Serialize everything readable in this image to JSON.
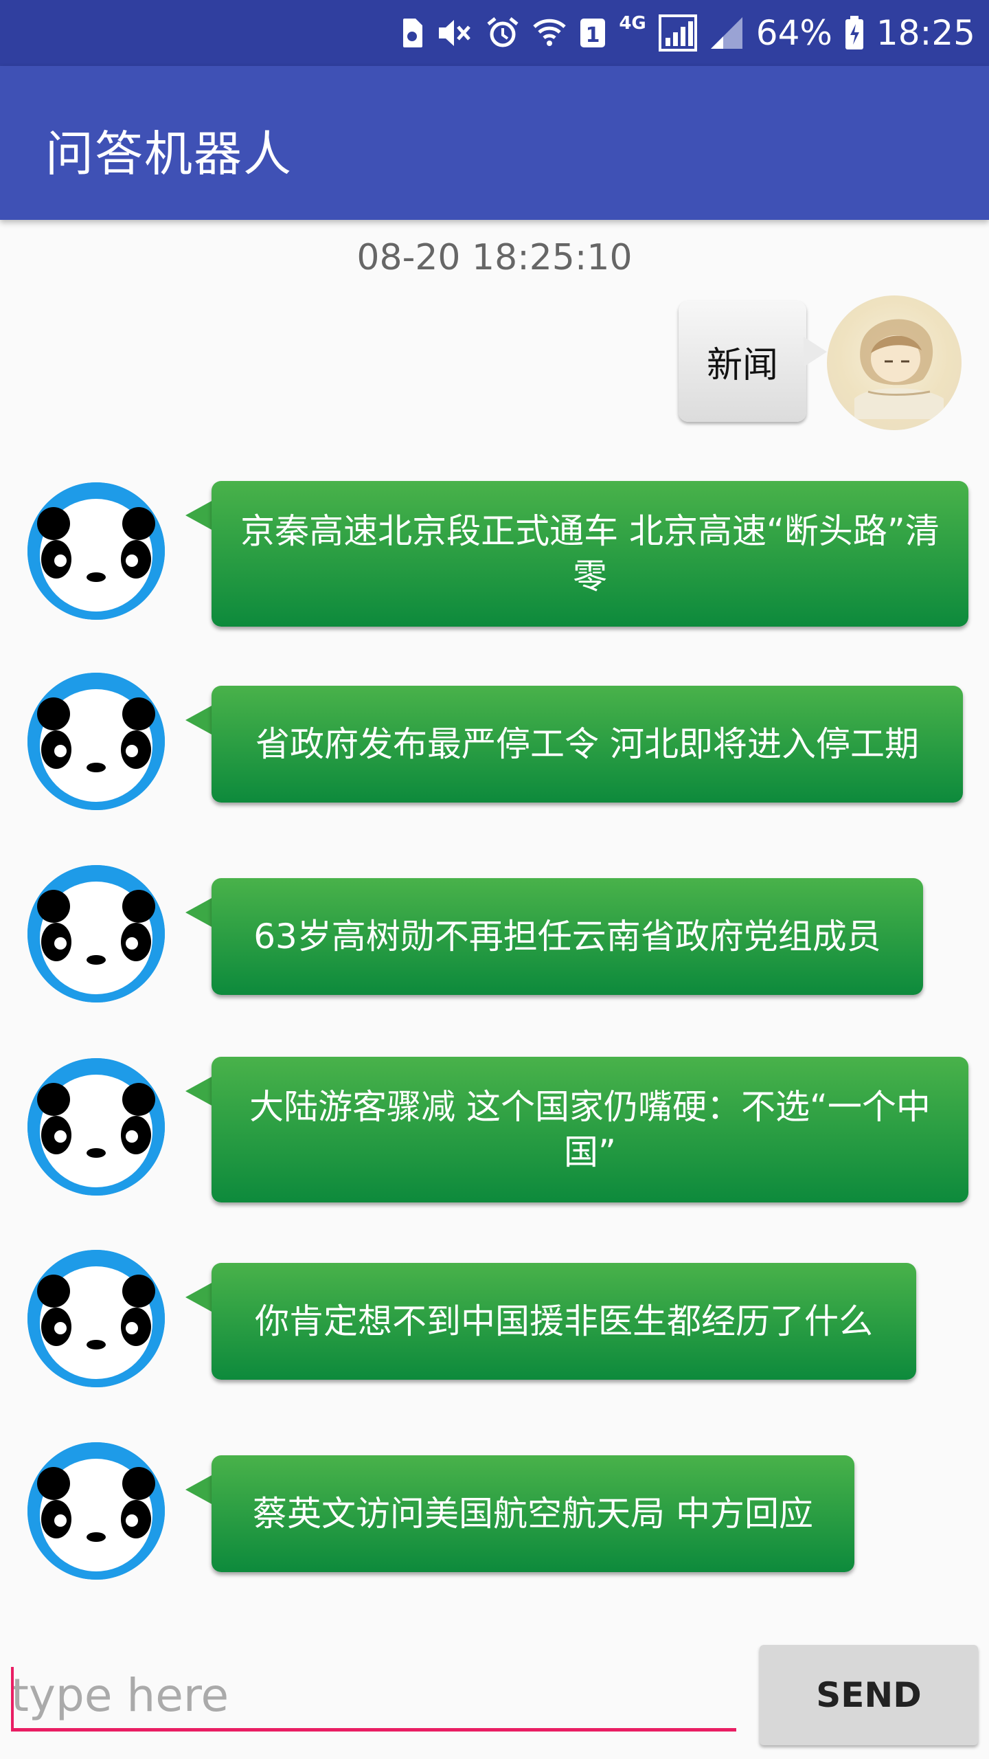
{
  "status_bar": {
    "network": "4G",
    "sim": "1",
    "battery_percent": "64%",
    "time": "18:25",
    "icons": [
      "sim-card-icon",
      "mute-icon",
      "alarm-icon",
      "wifi-icon",
      "sim-1-icon",
      "signal-icon",
      "signal-weak-icon",
      "battery-charging-icon"
    ]
  },
  "app_bar": {
    "title": "问答机器人"
  },
  "chat": {
    "timestamp": "08-20 18:25:10",
    "user_message": "新闻",
    "bot_messages": [
      "京秦高速北京段正式通车 北京高速“断头路”清零",
      "省政府发布最严停工令 河北即将进入停工期",
      "63岁高树勋不再担任云南省政府党组成员",
      "大陆游客骤减 这个国家仍嘴硬：不选“一个中国”",
      "你肯定想不到中国援非医生都经历了什么",
      "蔡英文访问美国航空航天局 中方回应"
    ]
  },
  "input": {
    "placeholder": "type here",
    "value": ""
  },
  "send_button": {
    "label": "SEND"
  },
  "colors": {
    "status_bar": "#303F9F",
    "app_bar": "#3F51B5",
    "bot_bubble": "#1E9640",
    "bot_avatar": "#1E9BE8",
    "input_underline": "#E91E63"
  }
}
